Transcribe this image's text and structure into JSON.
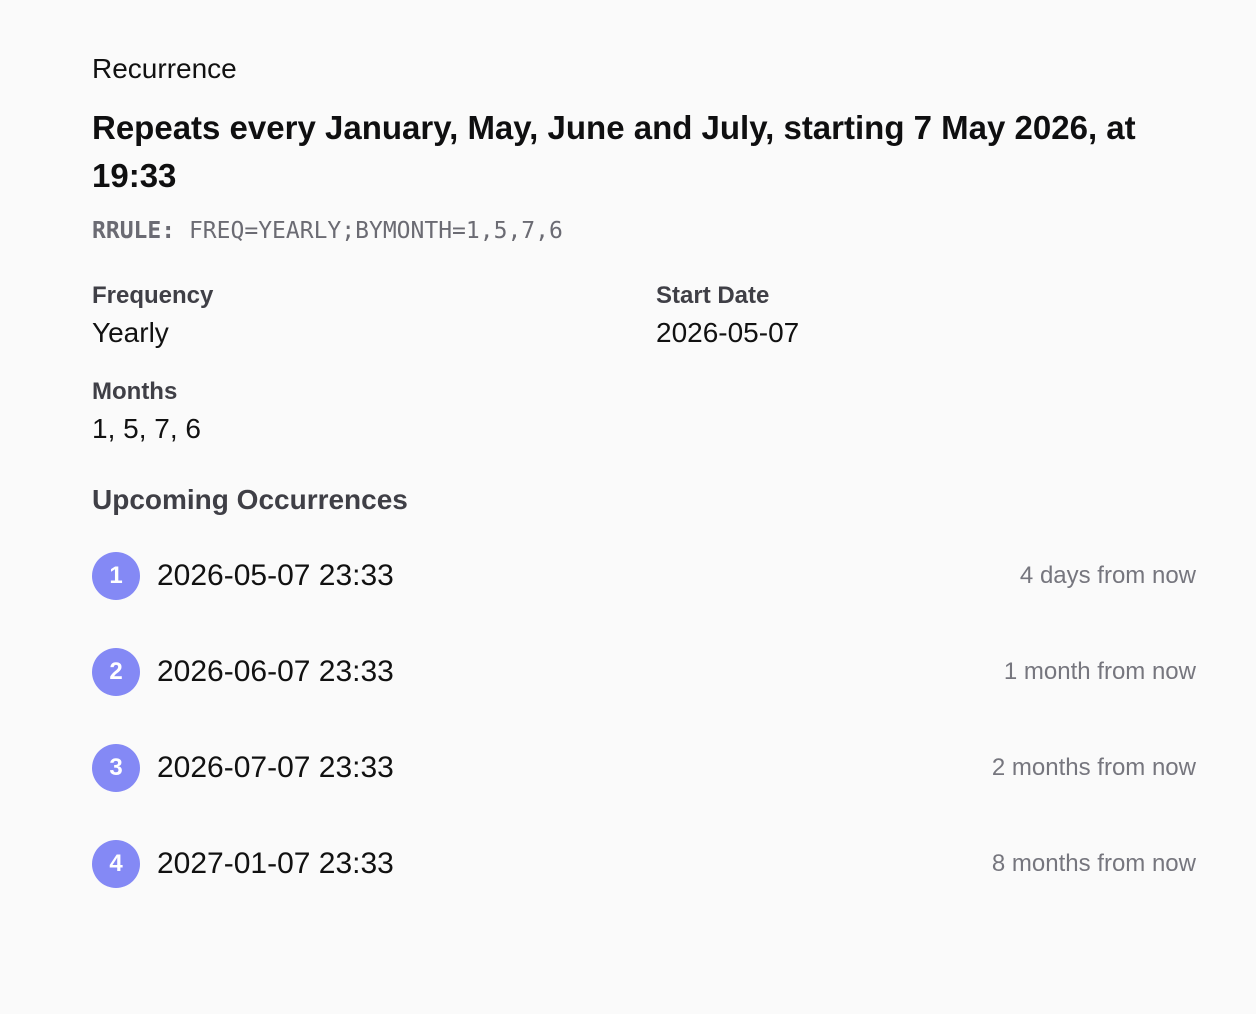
{
  "header": {
    "section_label": "Recurrence",
    "summary": "Repeats every January, May, June and July, starting 7 May 2026, at 19:33",
    "rrule_key": "RRULE:",
    "rrule_value": "FREQ=YEARLY;BYMONTH=1,5,7,6"
  },
  "fields": {
    "frequency": {
      "label": "Frequency",
      "value": "Yearly"
    },
    "start_date": {
      "label": "Start Date",
      "value": "2026-05-07"
    },
    "months": {
      "label": "Months",
      "value": "1, 5, 7, 6"
    }
  },
  "occurrences": {
    "title": "Upcoming Occurrences",
    "items": [
      {
        "index": "1",
        "datetime": "2026-05-07 23:33",
        "relative": "4 days from now"
      },
      {
        "index": "2",
        "datetime": "2026-06-07 23:33",
        "relative": "1 month from now"
      },
      {
        "index": "3",
        "datetime": "2026-07-07 23:33",
        "relative": "2 months from now"
      },
      {
        "index": "4",
        "datetime": "2027-01-07 23:33",
        "relative": "8 months from now"
      }
    ]
  },
  "colors": {
    "badge": "#8489f5",
    "background": "#fafafa",
    "muted_text": "#76767e"
  }
}
